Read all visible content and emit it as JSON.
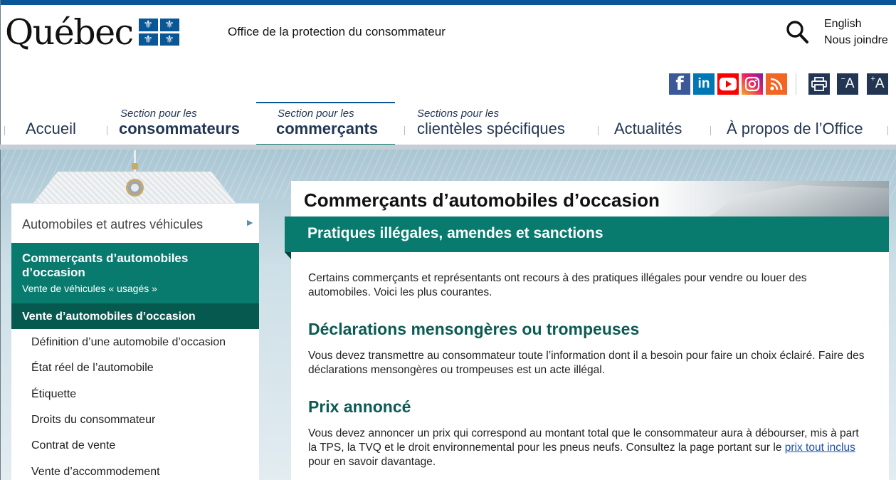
{
  "header": {
    "logo_text": "Québec",
    "office_name": "Office de la protection du consommateur",
    "language_link": "English",
    "contact_link": "Nous joindre",
    "socials": [
      "facebook-icon",
      "linkedin-icon",
      "youtube-icon",
      "instagram-icon",
      "rss-icon"
    ],
    "tools": {
      "print": "printer-icon",
      "decrease_text": "A",
      "increase_text": "A"
    }
  },
  "nav": {
    "home": "Accueil",
    "consumers": {
      "small": "Section pour les",
      "big": "consommateurs"
    },
    "merchants": {
      "small": "Section pour les",
      "big": "commerçants"
    },
    "specific": {
      "small": "Sections pour les",
      "big": "clientèles spécifiques"
    },
    "news": "Actualités",
    "about": "À propos de l’Office"
  },
  "sidebar": {
    "parent": "Automobiles et autres véhicules",
    "current_title": "Commerçants d’automobiles d’occasion",
    "current_subtitle": "Vente de véhicules « usagés »",
    "section": "Vente d’automobiles d’occasion",
    "links": [
      "Définition d’une automobile d’occasion",
      "État réel de l’automobile",
      "Étiquette",
      "Droits du consommateur",
      "Contrat de vente",
      "Vente d’accommodement"
    ]
  },
  "article": {
    "page_title": "Commerçants d’automobiles d’occasion",
    "band_title": "Pratiques illégales, amendes et sanctions",
    "intro": "Certains commerçants et représentants ont recours à des pratiques illégales pour vendre ou louer des automobiles. Voici les plus courantes.",
    "sections": [
      {
        "heading": "Déclarations mensongères ou trompeuses",
        "text": "Vous devez transmettre au consommateur toute l’information dont il a besoin pour faire un choix éclairé. Faire des déclarations mensongères ou trompeuses est un acte illégal."
      },
      {
        "heading": "Prix annoncé",
        "text_before": "Vous devez annoncer un prix qui correspond au montant total que le consommateur aura à débourser, mis à part la TPS, la TVQ et le droit environnemental pour les pneus neufs. Consultez la page portant sur le ",
        "link": "prix tout inclus",
        "text_after": " pour en savoir davantage."
      }
    ]
  }
}
